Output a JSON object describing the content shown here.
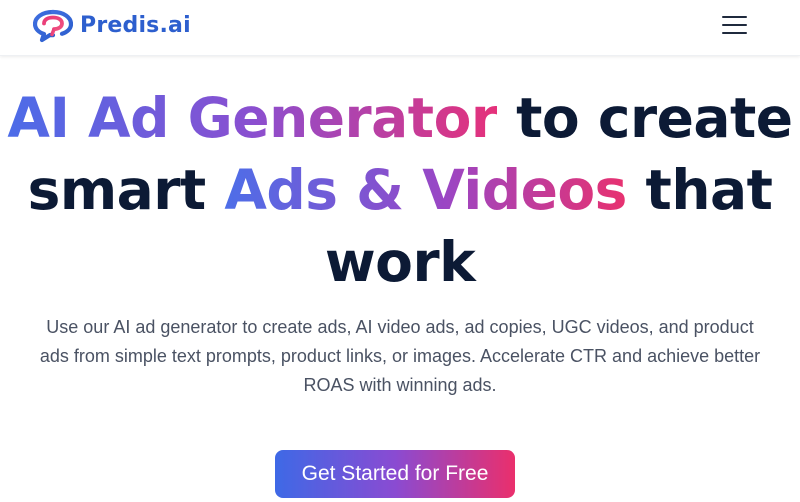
{
  "brand": {
    "name": "Predis.ai",
    "color": "#2d5fce",
    "logo_icon": "speech-bubble-logo-icon"
  },
  "header": {
    "menu_icon": "hamburger-menu-icon"
  },
  "hero": {
    "title": {
      "line1_grad": "AI Ad Generator",
      "line1_plain": " to create",
      "line2_plain_a": "smart ",
      "line2_grad": "Ads & Videos",
      "line2_plain_b": " that",
      "line3_plain": "work"
    },
    "subtitle": "Use our AI ad generator to create ads, AI video ads, ad copies, UGC videos, and product ads from simple text prompts, product links, or images. Accelerate CTR and achieve better ROAS with winning ads.",
    "cta_label": "Get Started for Free"
  },
  "colors": {
    "title_dark": "#0c1a35",
    "gradient_start": "#3e69e6",
    "gradient_mid": "#8a4bd2",
    "gradient_end": "#ea2f6c",
    "subtitle": "#4a5263"
  }
}
